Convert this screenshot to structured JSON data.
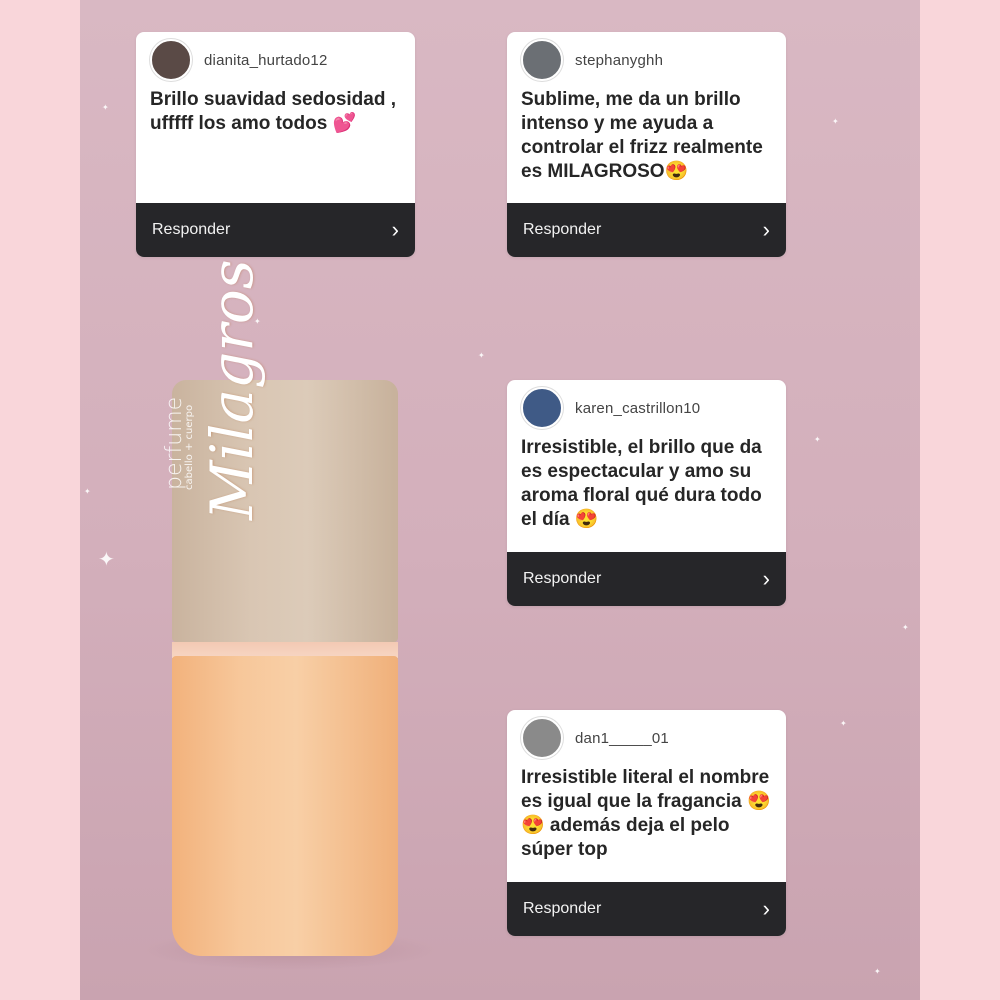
{
  "reply_label": "Responder",
  "comments": [
    {
      "username": "dianita_hurtado12",
      "text": "Brillo suavidad sedosidad , ufffff los amo todos 💕",
      "avatar_color": "#5a4a46"
    },
    {
      "username": "stephanyghh",
      "text": "Sublime, me da un brillo intenso y me ayuda a controlar el frizz realmente es MILAGROSO😍",
      "avatar_color": "#6b6f74"
    },
    {
      "username": "karen_castrillon10",
      "text": "Irresistible, el brillo que da es espectacular y amo su aroma floral qué dura todo el día 😍",
      "avatar_color": "#3f5a86"
    },
    {
      "username": "dan1_____01",
      "text": "Irresistible literal el nombre es igual que la fragancia 😍😍 además deja el pelo súper top",
      "avatar_color": "#8a8a8a"
    }
  ],
  "product": {
    "brand": "Milagros",
    "line1": "perfume",
    "line2": "cabello + cuerpo"
  },
  "colors": {
    "background": "#f9d6da",
    "panel": "#d6b4bf",
    "footer": "#262629",
    "cap": "#d9c6b3",
    "liquid": "#f7c79a"
  }
}
